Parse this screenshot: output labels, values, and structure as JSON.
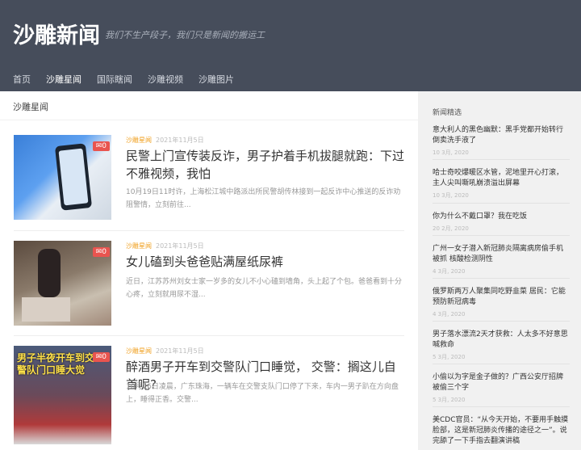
{
  "site": {
    "title": "沙雕新闻",
    "slogan": "我们不生产段子，我们只是新闻的搬运工"
  },
  "nav": [
    {
      "label": "首页"
    },
    {
      "label": "沙雕星闻"
    },
    {
      "label": "国际瞎闻"
    },
    {
      "label": "沙雕视频"
    },
    {
      "label": "沙雕图片"
    }
  ],
  "section": {
    "title": "沙雕星闻"
  },
  "articles": [
    {
      "category": "沙雕星闻",
      "date": "2021年11月5日",
      "comments": "0",
      "title": "民警上门宣传装反诈，男子护着手机拔腿就跑：下过不雅视频，我怕",
      "excerpt": "10月19日11时许，上海松江城中路派出所民警胡传林接到一起反诈中心推送的反诈劝阻警情，立刻前往..."
    },
    {
      "category": "沙雕星闻",
      "date": "2021年11月5日",
      "comments": "0",
      "title": "女儿磕到头爸爸贴满屋纸尿裤",
      "excerpt": "近日，江苏苏州刘女士家一岁多的女儿不小心磕到墙角，头上起了个包。爸爸看到十分心疼，立刻就用尿不湿..."
    },
    {
      "category": "沙雕星闻",
      "date": "2021年11月5日",
      "comments": "0",
      "title": "醉酒男子开车到交警队门口睡觉， 交警：搁这儿自首呢?",
      "excerpt": "10月26日凌晨，广东珠海，一辆车在交警支队门口停了下来，车内一男子趴在方向盘上，睡得正香。交警...",
      "thumb_caption": "男子半夜开车到交警队门口睡大觉"
    }
  ],
  "sidebar": {
    "title": "新闻精选",
    "items": [
      {
        "title": "意大利人的黑色幽默：黑手党都开始转行倒卖洗手液了",
        "date": "10 3月, 2020"
      },
      {
        "title": "哈士奇咬爆暖区水管，泥地里开心打滚，主人尖叫嘶吼崩溃溢出屏幕",
        "date": "10 3月, 2020"
      },
      {
        "title": "你为什么不戴口罩？我在吃饭",
        "date": "20 2月, 2020"
      },
      {
        "title": "广州一女子潜入新冠肺炎隔离病房偷手机被抓 核酸检测阴性",
        "date": "4 3月, 2020"
      },
      {
        "title": "俄罗斯两万人聚集同吃野韭菜 居民：它能预防新冠病毒",
        "date": "4 3月, 2020"
      },
      {
        "title": "男子落水漂流2天才获救：人太多不好意思喊救命",
        "date": "5 3月, 2020"
      },
      {
        "title": "小偷以为字是金子做的？广西公安厅招牌被偷三个字",
        "date": "5 3月, 2020"
      },
      {
        "title": "美CDC官员：“从今天开始，不要用手触摸脸部，这是新冠肺炎传播的途径之一”。说完舔了一下手指去翻演讲稿",
        "date": ""
      }
    ]
  }
}
